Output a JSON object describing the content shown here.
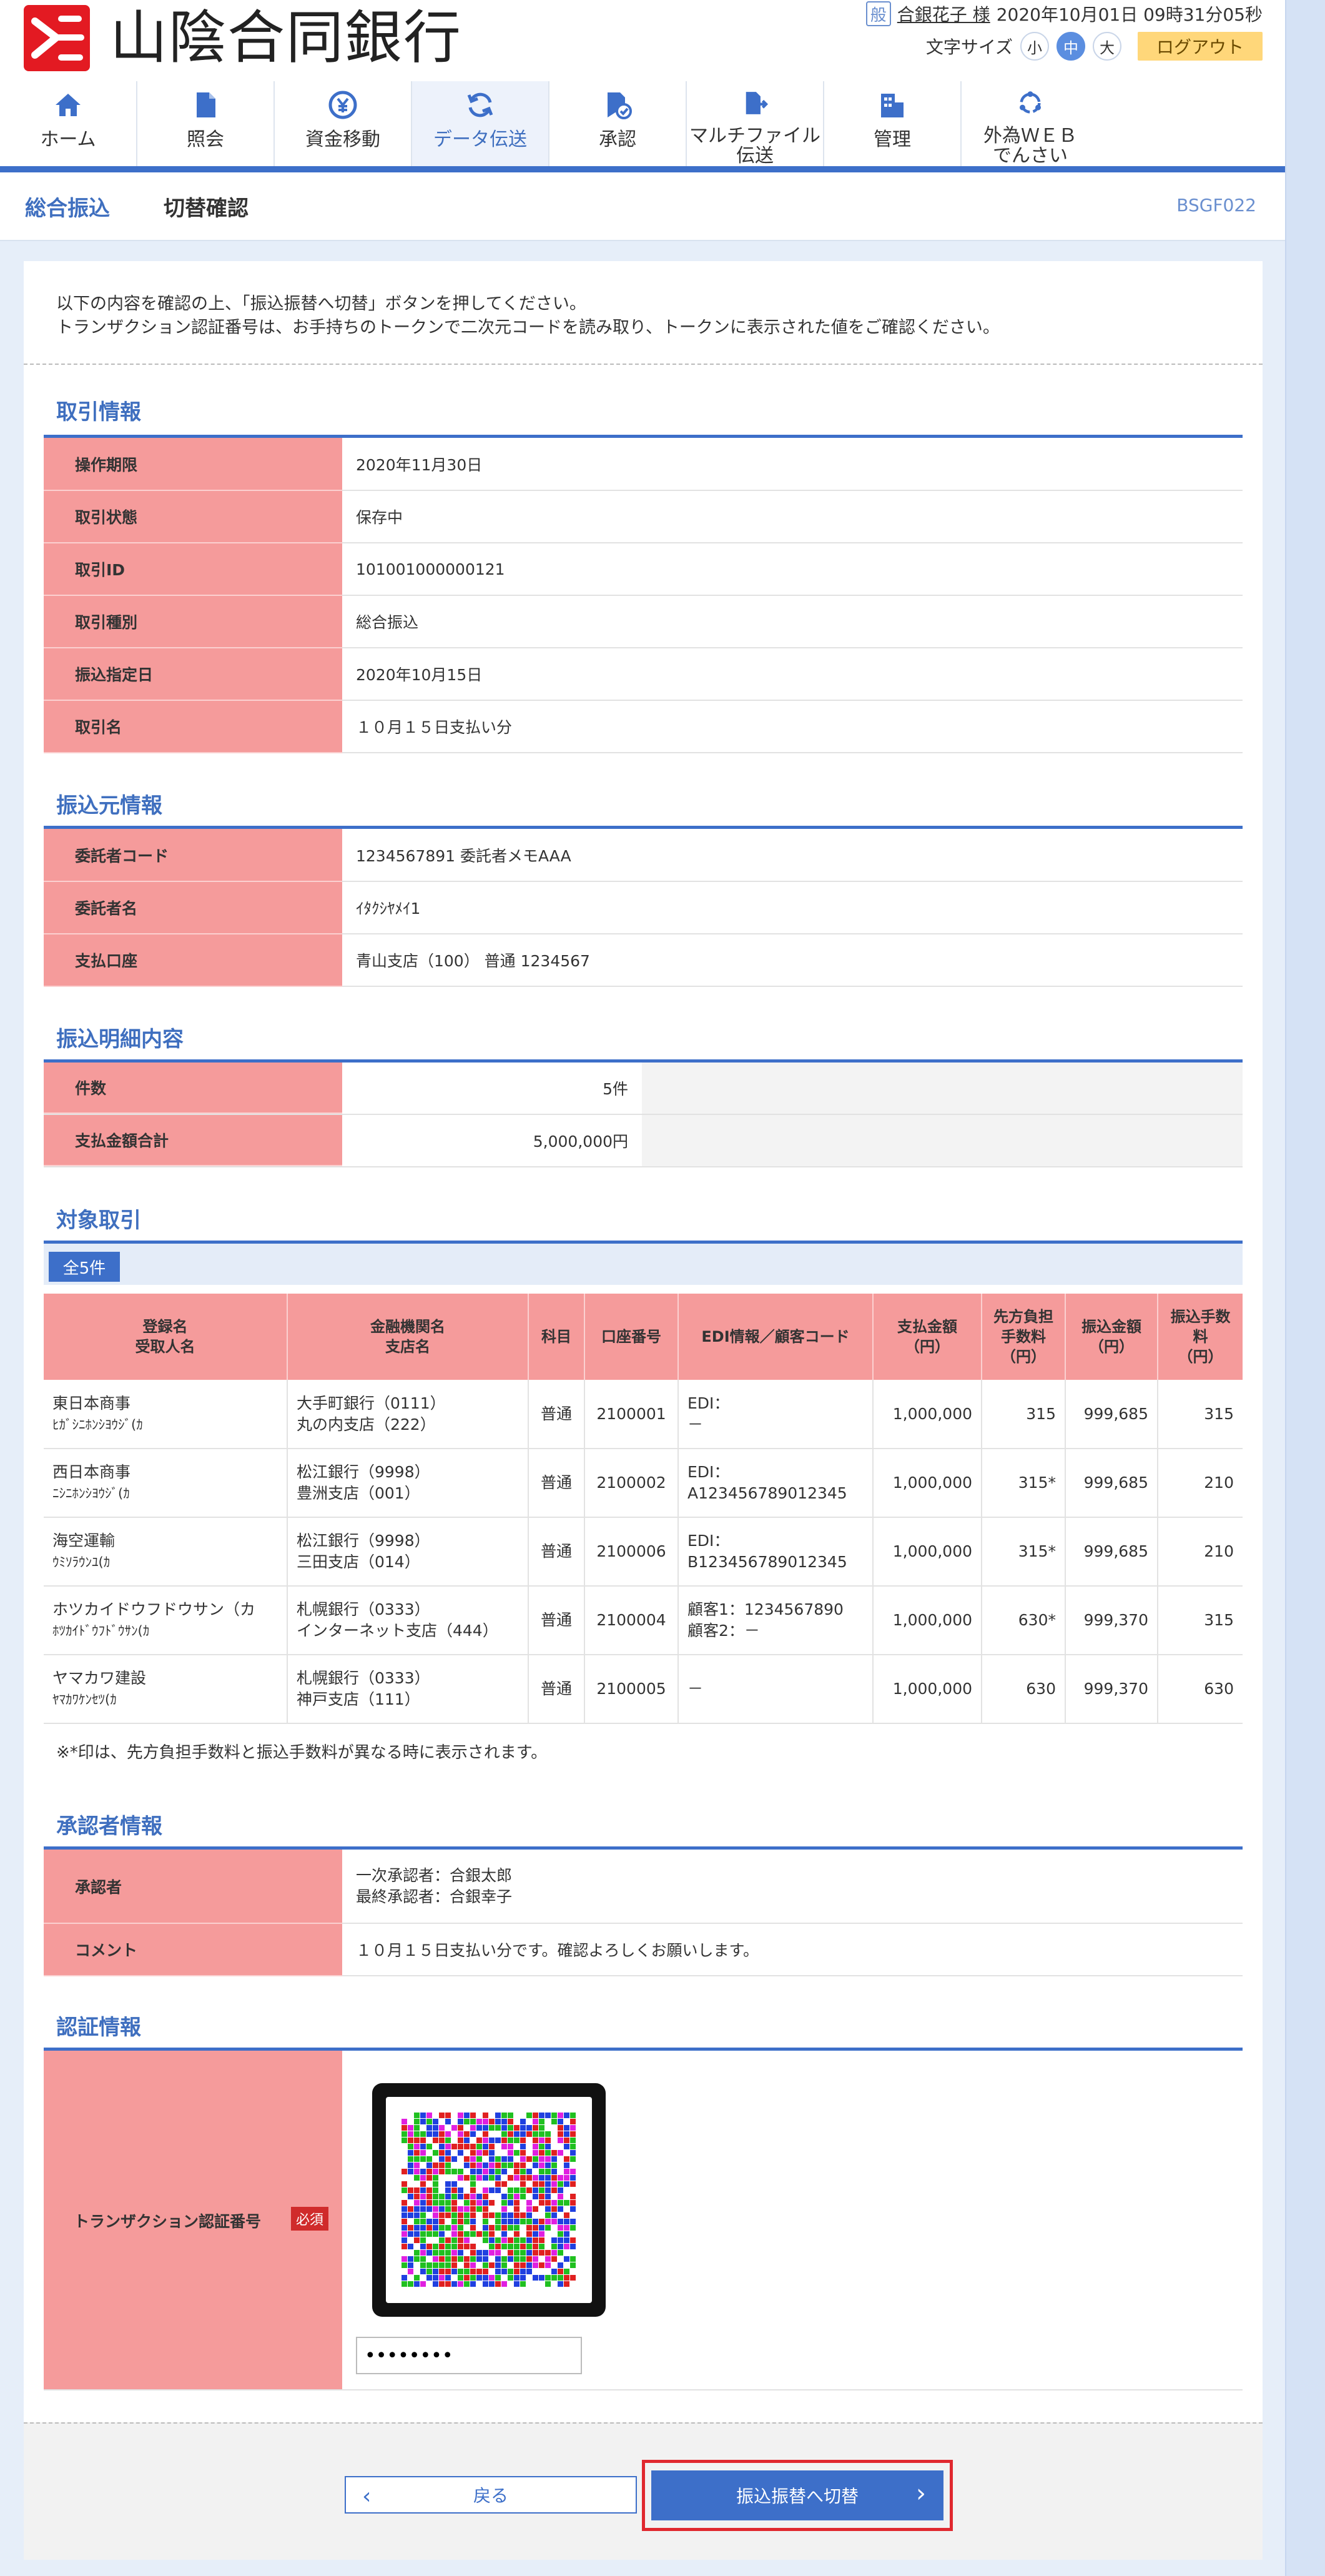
{
  "header": {
    "bank_name": "山陰合同銀行",
    "user_icon": "般",
    "user_name": "合銀花子 様",
    "datetime": "2020年10月01日 09時31分05秒",
    "font_size_label": "文字サイズ",
    "font_sizes": [
      "小",
      "中",
      "大"
    ],
    "logout_label": "ログアウト"
  },
  "nav": [
    {
      "label": "ホーム",
      "icon": "home-icon"
    },
    {
      "label": "照会",
      "icon": "document-icon"
    },
    {
      "label": "資金移動",
      "icon": "yen-transfer-icon"
    },
    {
      "label": "データ伝送",
      "icon": "sync-icon"
    },
    {
      "label": "承認",
      "icon": "approve-icon"
    },
    {
      "label": "マルチファイル\n伝送",
      "icon": "file-send-icon"
    },
    {
      "label": "管理",
      "icon": "building-icon"
    },
    {
      "label": "外為ＷＥＢ\nでんさい",
      "icon": "exchange-icon"
    }
  ],
  "breadcrumb": {
    "category": "総合振込",
    "page": "切替確認",
    "screen_id": "BSGF022"
  },
  "intro": [
    "以下の内容を確認の上、「振込振替へ切替」ボタンを押してください。",
    "トランザクション認証番号は、お手持ちのトークンで二次元コードを読み取り、トークンに表示された値をご確認ください。"
  ],
  "sections": {
    "transaction": {
      "title": "取引情報",
      "rows": [
        {
          "k": "操作期限",
          "v": "2020年11月30日"
        },
        {
          "k": "取引状態",
          "v": "保存中"
        },
        {
          "k": "取引ID",
          "v": "101001000000121"
        },
        {
          "k": "取引種別",
          "v": "総合振込"
        },
        {
          "k": "振込指定日",
          "v": "2020年10月15日"
        },
        {
          "k": "取引名",
          "v": "１０月１５日支払い分"
        }
      ]
    },
    "source": {
      "title": "振込元情報",
      "rows": [
        {
          "k": "委託者コード",
          "v": "1234567891 委託者メモAAA"
        },
        {
          "k": "委託者名",
          "v": "ｲﾀｸｼﾔﾒｲ1"
        },
        {
          "k": "支払口座",
          "v": "青山支店（100） 普通 1234567"
        }
      ]
    },
    "detail": {
      "title": "振込明細内容",
      "rows": [
        {
          "k": "件数",
          "v": "5件"
        },
        {
          "k": "支払金額合計",
          "v": "5,000,000円"
        }
      ]
    },
    "targets": {
      "title": "対象取引",
      "count_tag": "全5件",
      "headers": [
        "登録名\n受取人名",
        "金融機関名\n支店名",
        "科目",
        "口座番号",
        "EDI情報／顧客コード",
        "支払金額\n（円）",
        "先方負担\n手数料\n（円）",
        "振込金額\n（円）",
        "振込手数\n料\n（円）"
      ],
      "rows": [
        {
          "name": "東日本商事",
          "kana": "ﾋｶﾞｼﾆﾎﾝｼﾖｳｼﾞ(ｶ",
          "bank": "大手町銀行（0111）",
          "branch": "丸の内支店（222）",
          "type": "普通",
          "acct": "2100001",
          "edi1": "EDI：",
          "edi2": "－",
          "pay": "1,000,000",
          "fee": "315",
          "amt": "999,685",
          "tfee": "315"
        },
        {
          "name": "西日本商事",
          "kana": "ﾆｼﾆﾎﾝｼﾖｳｼﾞ(ｶ",
          "bank": "松江銀行（9998）",
          "branch": "豊洲支店（001）",
          "type": "普通",
          "acct": "2100002",
          "edi1": "EDI：",
          "edi2": "A123456789012345",
          "pay": "1,000,000",
          "fee": "315*",
          "amt": "999,685",
          "tfee": "210"
        },
        {
          "name": "海空運輸",
          "kana": "ｳﾐｿﾗｳﾝﾕ(ｶ",
          "bank": "松江銀行（9998）",
          "branch": "三田支店（014）",
          "type": "普通",
          "acct": "2100006",
          "edi1": "EDI：",
          "edi2": "B123456789012345",
          "pay": "1,000,000",
          "fee": "315*",
          "amt": "999,685",
          "tfee": "210"
        },
        {
          "name": "ホツカイドウフドウサン（カ",
          "kana": "ﾎﾂｶｲﾄﾞｳﾌﾄﾞｳｻﾝ(ｶ",
          "bank": "札幌銀行（0333）",
          "branch": "インターネット支店（444）",
          "type": "普通",
          "acct": "2100004",
          "edi1": "顧客1：1234567890",
          "edi2": "顧客2：－",
          "pay": "1,000,000",
          "fee": "630*",
          "amt": "999,370",
          "tfee": "315"
        },
        {
          "name": "ヤマカワ建設",
          "kana": "ﾔﾏｶﾜｹﾝｾﾂ(ｶ",
          "bank": "札幌銀行（0333）",
          "branch": "神戸支店（111）",
          "type": "普通",
          "acct": "2100005",
          "edi1": "－",
          "edi2": "",
          "pay": "1,000,000",
          "fee": "630",
          "amt": "999,370",
          "tfee": "630"
        }
      ],
      "note": "※*印は、先方負担手数料と振込手数料が異なる時に表示されます。"
    },
    "approver": {
      "title": "承認者情報",
      "approver_label": "承認者",
      "approver_line1": "一次承認者：合銀太郎",
      "approver_line2": "最終承認者：合銀幸子",
      "comment_label": "コメント",
      "comment": "１０月１５日支払い分です。確認よろしくお願いします。"
    },
    "auth": {
      "title": "認証情報",
      "label": "トランザクション認証番号",
      "required": "必須",
      "password_value": "••••••••"
    }
  },
  "buttons": {
    "back": "戻る",
    "submit": "振込振替へ切替"
  },
  "colors": {
    "accent": "#3d6fc9",
    "key_bg": "#f59b9b",
    "logout": "#ffd77a",
    "highlight": "#e0282f"
  }
}
